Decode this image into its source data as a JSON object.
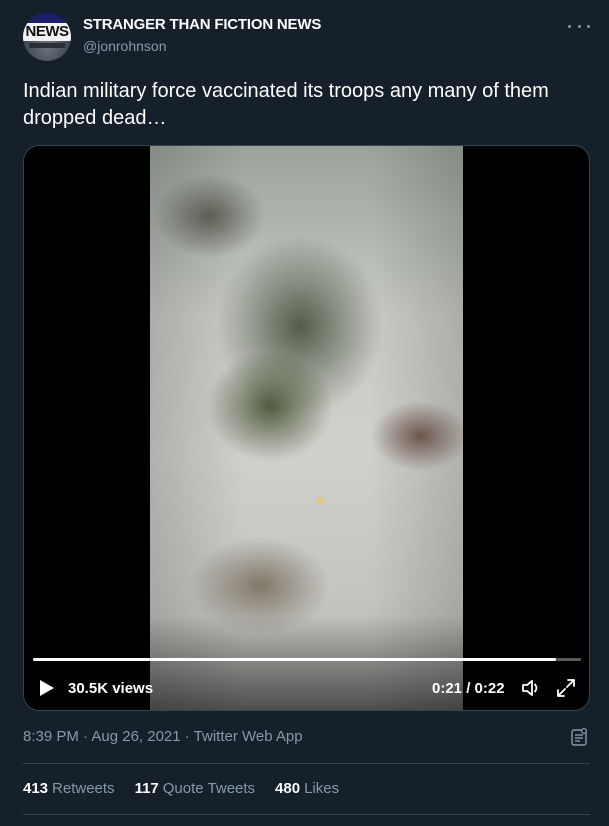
{
  "author": {
    "name": "STRANGER THAN FICTION NEWS",
    "handle": "@jonrohnson",
    "avatar_text": "NEWS"
  },
  "tweet": {
    "text": "Indian military force vaccinated its troops any many of them dropped dead…",
    "timestamp": "8:39 PM · Aug 26, 2021 · Twitter Web App"
  },
  "video": {
    "views": "30.5K views",
    "time": "0:21 / 0:22",
    "progress_fraction": 0.955
  },
  "stats": {
    "retweets_count": "413",
    "retweets_label": "Retweets",
    "quote_count": "117",
    "quote_label": "Quote Tweets",
    "likes_count": "480",
    "likes_label": "Likes"
  },
  "icons": {
    "more": "more-icon",
    "play": "play-icon",
    "volume": "volume-icon",
    "expand": "expand-icon",
    "analytics": "analytics-icon"
  },
  "colors": {
    "background": "#15202b",
    "secondary_text": "#8899a6",
    "border": "#38444d"
  }
}
